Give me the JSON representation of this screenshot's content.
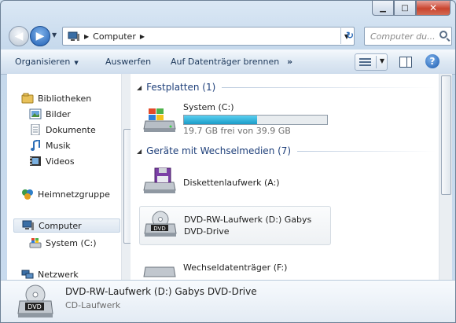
{
  "address": {
    "location": "Computer"
  },
  "search": {
    "placeholder": "Computer du..."
  },
  "toolbar": {
    "organize": "Organisieren",
    "eject": "Auswerfen",
    "burn": "Auf Datenträger brennen",
    "more": "»"
  },
  "nav": {
    "libraries": "Bibliotheken",
    "pictures": "Bilder",
    "documents": "Dokumente",
    "music": "Musik",
    "videos": "Videos",
    "homegroup": "Heimnetzgruppe",
    "computer": "Computer",
    "system": "System (C:)",
    "network": "Netzwerk"
  },
  "groups": {
    "harddisks": "Festplatten (1)",
    "removable": "Geräte mit Wechselmedien (7)"
  },
  "drives": {
    "system": {
      "name": "System (C:)",
      "free": "19.7 GB frei von 39.9 GB",
      "used_fraction": 0.51
    },
    "floppy": {
      "name": "Diskettenlaufwerk (A:)"
    },
    "dvd": {
      "name": "DVD-RW-Laufwerk (D:) Gabys",
      "name2": "DVD-Drive"
    },
    "removable": {
      "name": "Wechseldatenträger (F:)"
    }
  },
  "details": {
    "title": "DVD-RW-Laufwerk (D:) Gabys DVD-Drive",
    "type": "CD-Laufwerk"
  }
}
